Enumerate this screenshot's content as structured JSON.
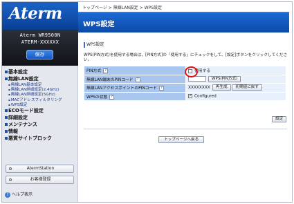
{
  "brand": {
    "logo_text": "Aterm",
    "model_line1": "Aterm WR9500N",
    "model_line2": "ATERM-XXXXXX",
    "save_label": "保存"
  },
  "breadcrumb": {
    "home": "トップページ",
    "sep1": " > ",
    "wireless": "無線LAN設定",
    "sep2": " > ",
    "current": "WPS設定"
  },
  "page": {
    "title": "WPS設定",
    "section_title": "WPS設定",
    "description": "WPS(PIN方式)を使用する場合は、[PIN方式]の「使用する」にチェックをして、[設定]ボタンをクリックしてください。"
  },
  "nav": {
    "basic": "基本設定",
    "wireless": "無線LAN設定",
    "wireless_items": [
      "無線LAN基本設定",
      "無線LAN詳細設定(2.4GHz)",
      "無線LAN詳細設定(5GHz)",
      "MACアドレスフィルタリング",
      "WPS設定"
    ],
    "eco": "ECOモード設定",
    "detail": "詳細設定",
    "maintenance": "メンテナンス",
    "info": "情報",
    "malicious_block": "悪質サイトブロック"
  },
  "side_buttons": {
    "station": "AtermStation",
    "support": "お客様登録"
  },
  "help": {
    "label": "ヘルプ表示"
  },
  "table": {
    "rows": [
      {
        "label": "PIN方式",
        "checkbox_label": "使用する",
        "checked": false
      },
      {
        "label": "無線LAN端末のPINコード",
        "input_value": "",
        "button": "WPS(PIN方式)"
      },
      {
        "label": "無線LANアクセスポイントのPINコード",
        "pin_value": "XXXXXXXX",
        "button_regen": "再生成",
        "button_reset": "初期値に戻す"
      },
      {
        "label": "WPSの状態",
        "checkbox_label": "Configured",
        "checked": true
      }
    ],
    "help_glyph": "?"
  },
  "actions": {
    "set_label": "設定",
    "back_to_top": "トップページへ戻る"
  },
  "colors": {
    "accent": "#0b4aa8",
    "label_cell": "#a9c6ee",
    "value_cell": "#e8f0fb",
    "highlight": "#e01010"
  }
}
